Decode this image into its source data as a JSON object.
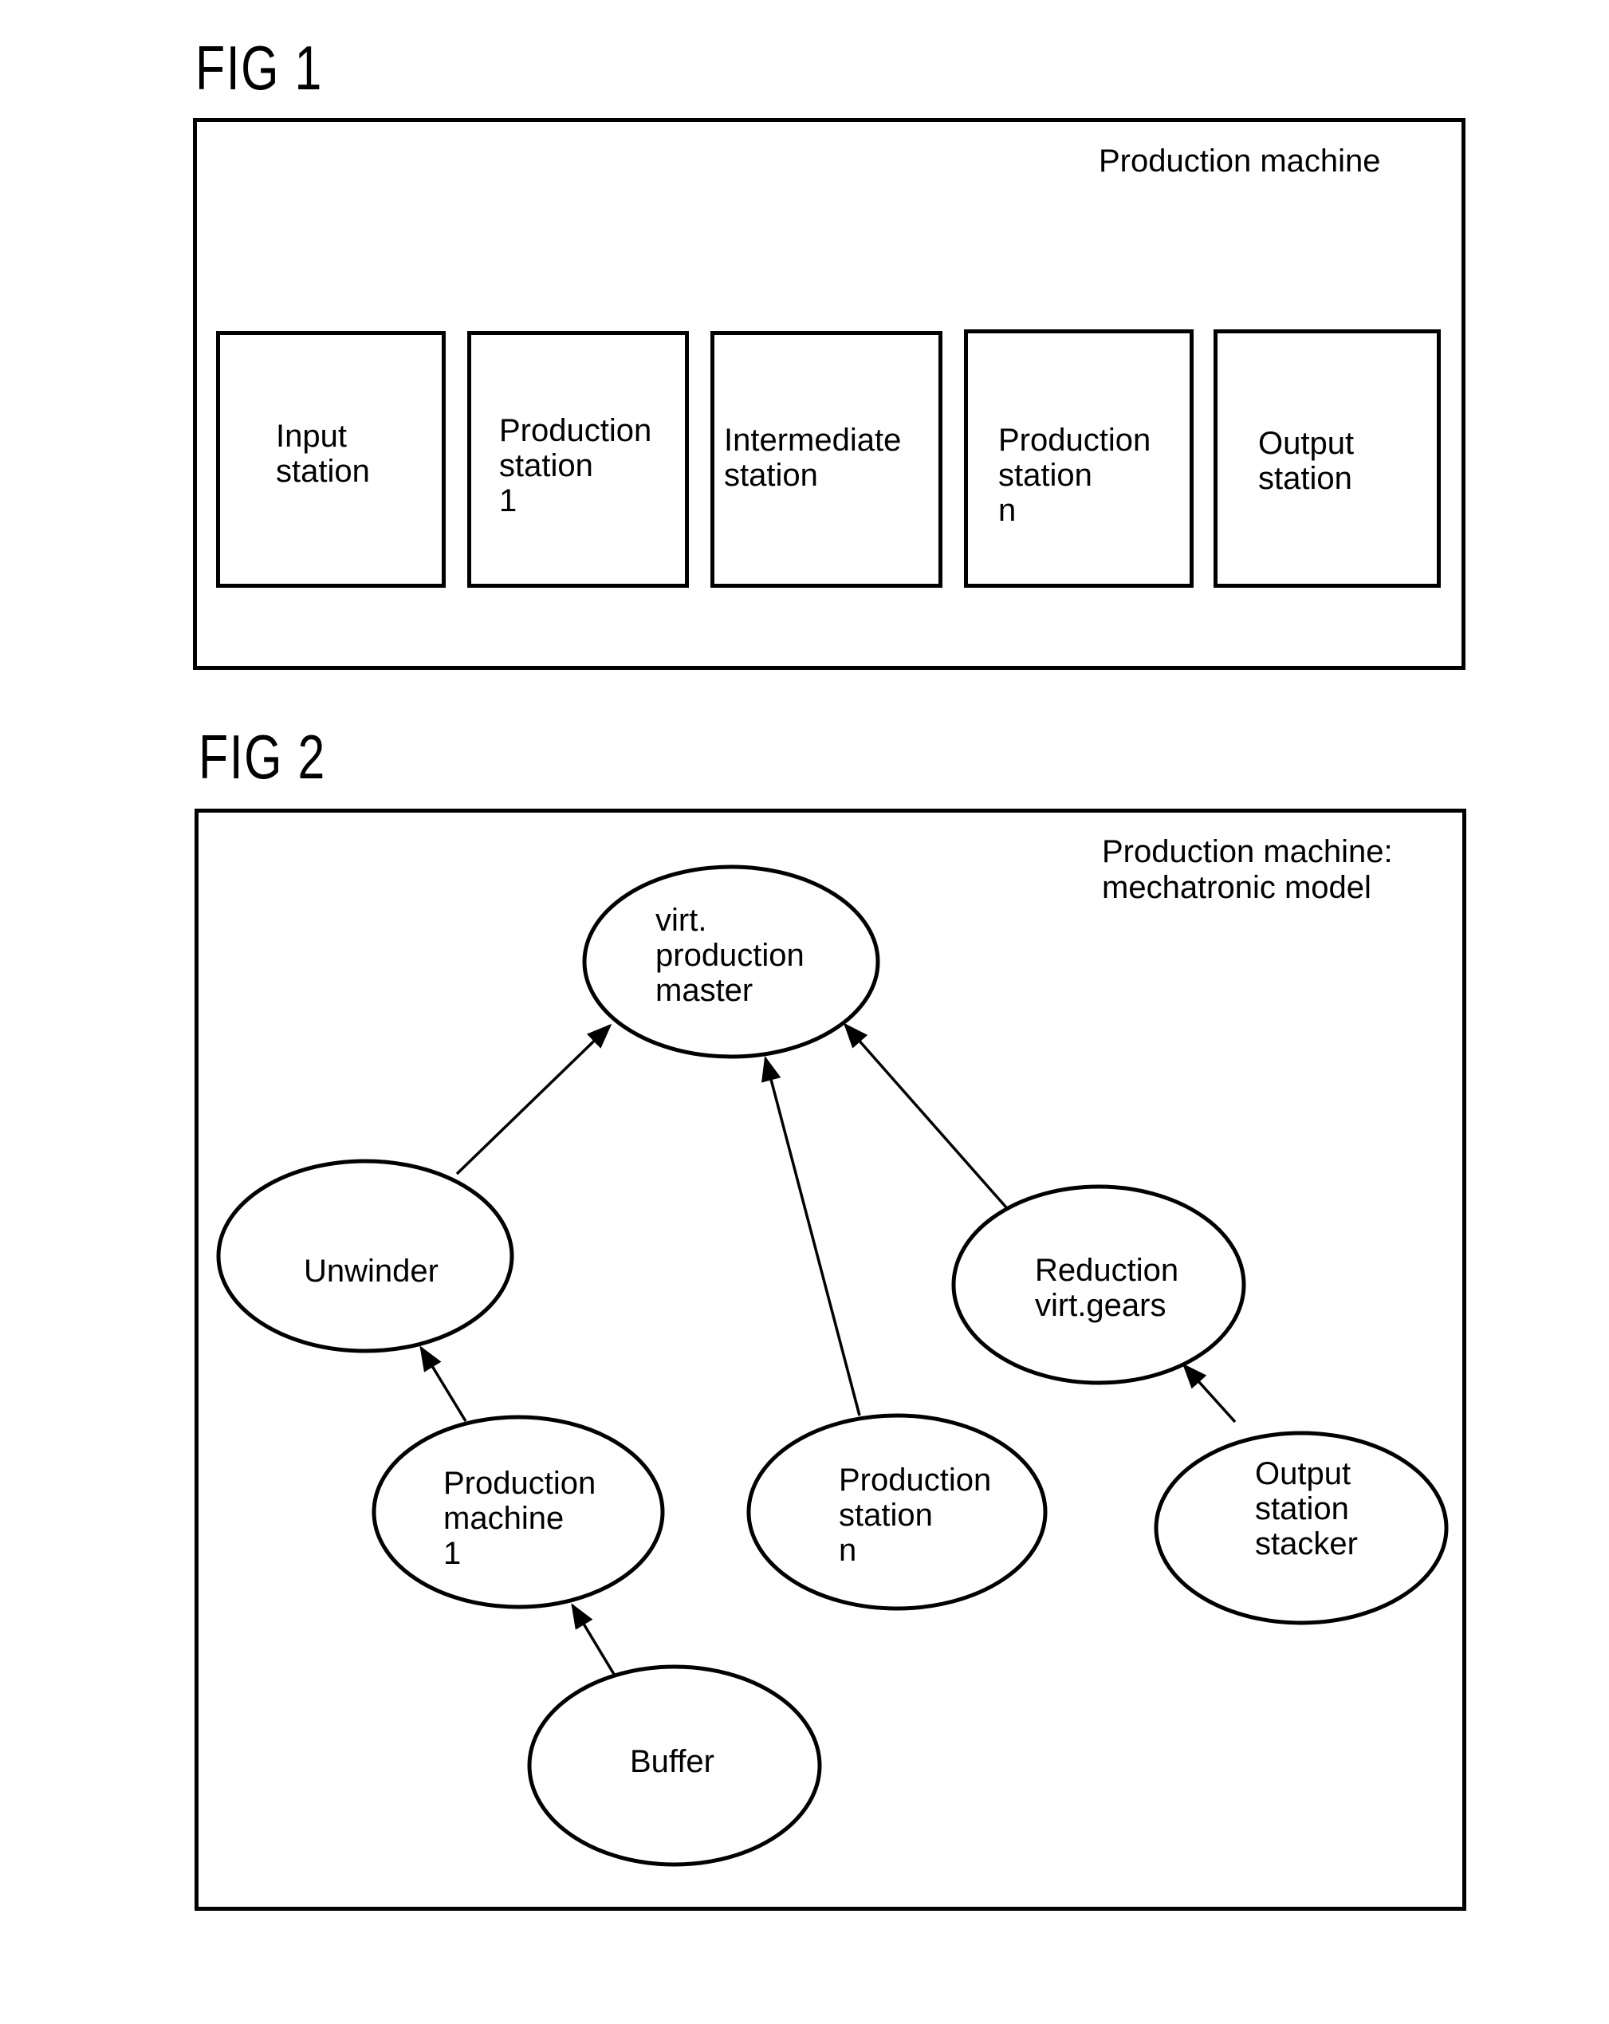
{
  "fig1": {
    "label": "FIG 1",
    "frame_title": "Production machine",
    "stations": [
      {
        "id": "input-station",
        "text": "Input\nstation"
      },
      {
        "id": "production-station-1",
        "text": "Production\nstation\n1"
      },
      {
        "id": "intermediate-station",
        "text": "Intermediate\nstation"
      },
      {
        "id": "production-station-n",
        "text": "Production\nstation\nn"
      },
      {
        "id": "output-station",
        "text": "Output\nstation"
      }
    ]
  },
  "fig2": {
    "label": "FIG 2",
    "frame_title": "Production machine:\nmechatronic model",
    "nodes": [
      {
        "id": "virt-production-master",
        "text": "virt.\nproduction\nmaster"
      },
      {
        "id": "unwinder",
        "text": "Unwinder"
      },
      {
        "id": "reduction-virt-gears",
        "text": "Reduction\nvirt.gears"
      },
      {
        "id": "production-machine-1",
        "text": "Production\nmachine\n1"
      },
      {
        "id": "production-station-n",
        "text": "Production\nstation\nn"
      },
      {
        "id": "output-station-stacker",
        "text": "Output\nstation\nstacker"
      },
      {
        "id": "buffer",
        "text": "Buffer"
      }
    ],
    "edges": [
      {
        "from": "unwinder",
        "to": "virt-production-master"
      },
      {
        "from": "production-station-n",
        "to": "virt-production-master"
      },
      {
        "from": "reduction-virt-gears",
        "to": "virt-production-master"
      },
      {
        "from": "production-machine-1",
        "to": "unwinder"
      },
      {
        "from": "output-station-stacker",
        "to": "reduction-virt-gears"
      },
      {
        "from": "buffer",
        "to": "production-machine-1"
      }
    ]
  }
}
